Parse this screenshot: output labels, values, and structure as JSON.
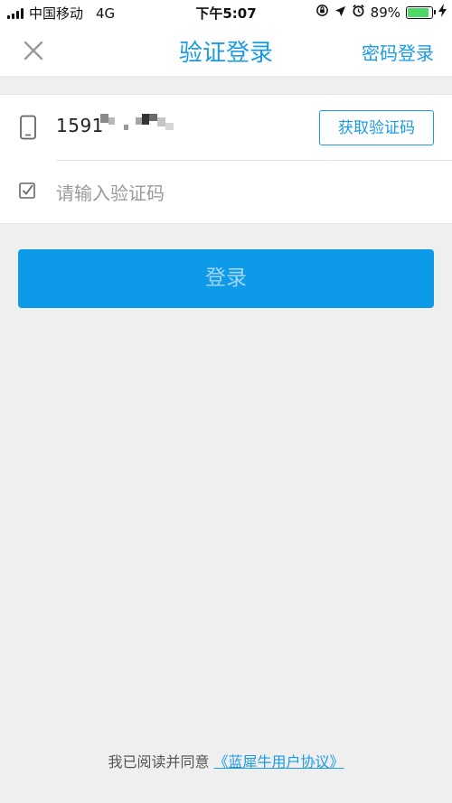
{
  "status_bar": {
    "carrier": "中国移动",
    "network": "4G",
    "time": "下午5:07",
    "battery_percent": "89%",
    "battery_level": 0.89,
    "icons": [
      "orientation-lock-icon",
      "location-arrow-icon",
      "alarm-icon",
      "battery-icon",
      "charging-bolt-icon"
    ]
  },
  "nav": {
    "title": "验证登录",
    "right_action": "密码登录",
    "left_icon": "close-icon"
  },
  "form": {
    "phone_value": "1591",
    "phone_icon": "phone-icon",
    "get_code_label": "获取验证码",
    "code_placeholder": "请输入验证码",
    "code_icon": "checkbox-icon"
  },
  "login_button": "登录",
  "agreement": {
    "prefix": "我已阅读并同意",
    "link": "《蓝犀牛用户协议》"
  },
  "colors": {
    "accent": "#1a9be6",
    "button_bg": "#0d9ae8",
    "button_text": "#a3d5f5",
    "page_bg": "#efefef",
    "battery": "#4cd964"
  }
}
